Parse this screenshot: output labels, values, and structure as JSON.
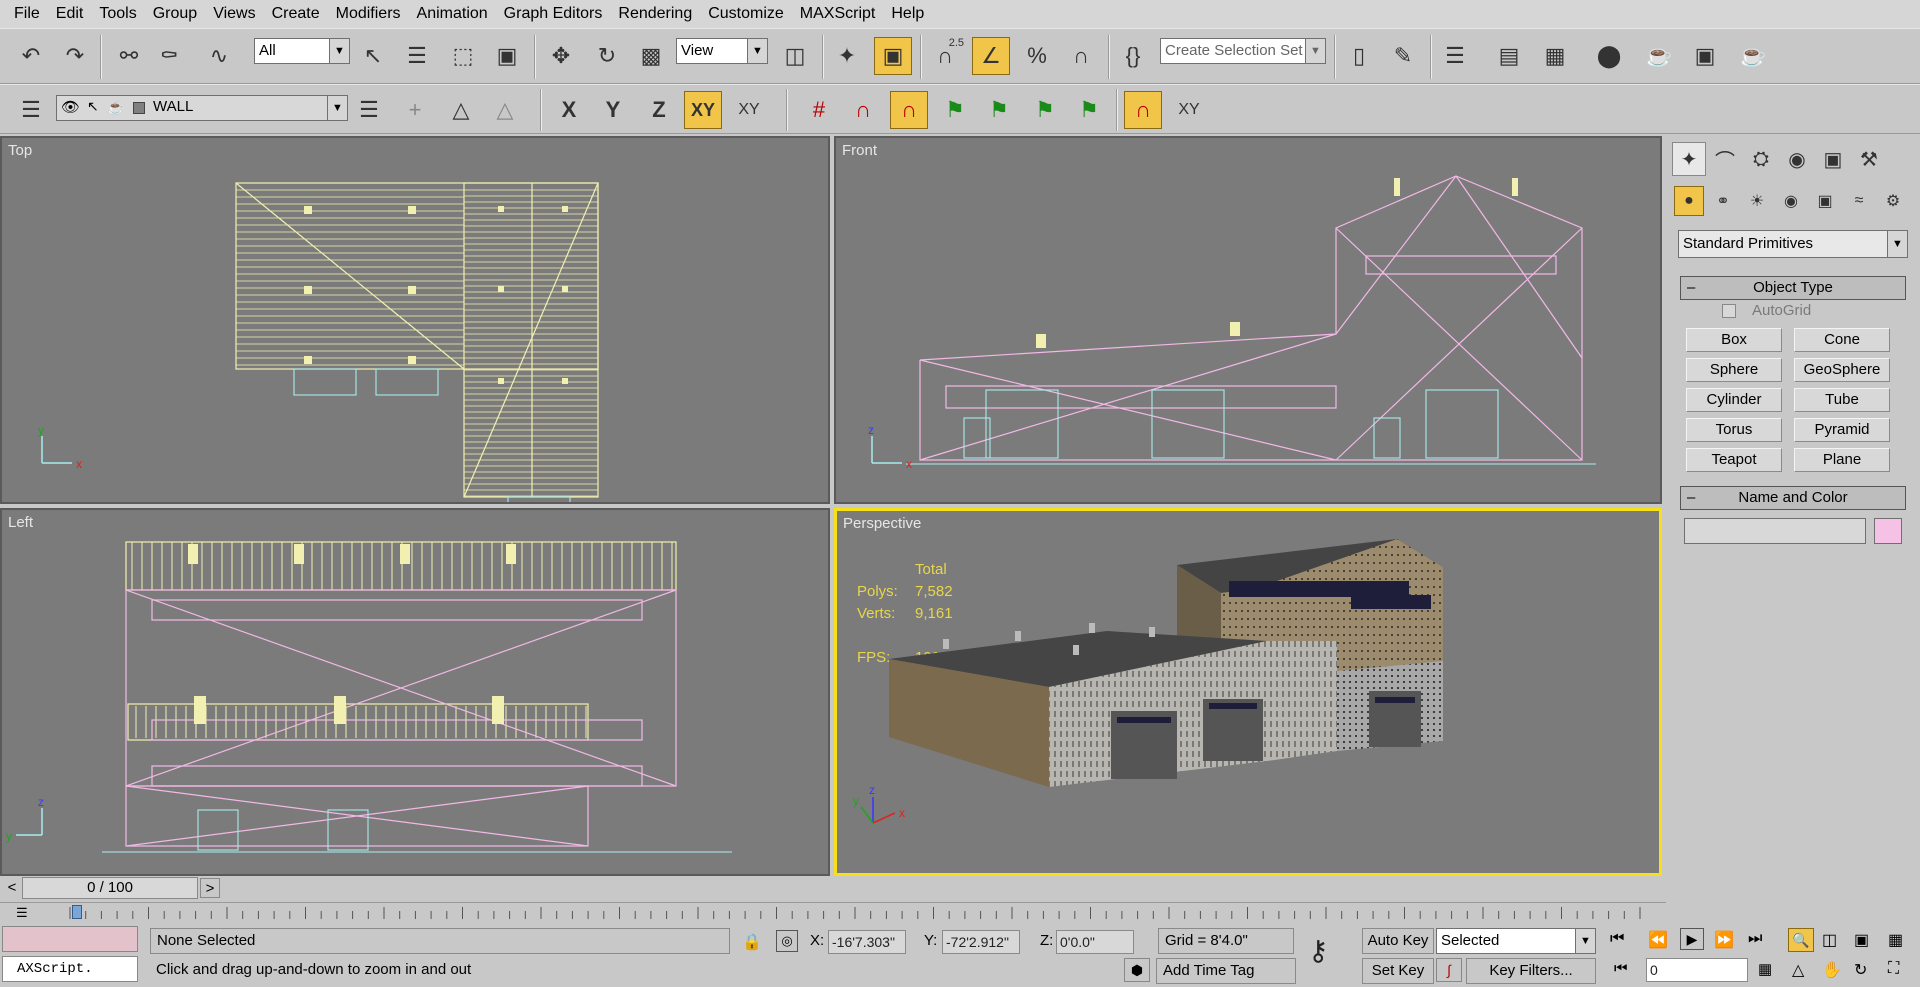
{
  "menu": [
    "File",
    "Edit",
    "Tools",
    "Group",
    "Views",
    "Create",
    "Modifiers",
    "Animation",
    "Graph Editors",
    "Rendering",
    "Customize",
    "MAXScript",
    "Help"
  ],
  "toolbar1": {
    "selection_filter": "All",
    "reference_coord": "View",
    "snap_angle_label": "2.5",
    "selection_set_placeholder": "Create Selection Set"
  },
  "toolbar2": {
    "layer_name": "WALL",
    "axis_x": "X",
    "axis_y": "Y",
    "axis_z": "Z",
    "axis_xy": "XY",
    "axis_xy2": "XY",
    "axis_xy3": "XY"
  },
  "viewports": {
    "top": "Top",
    "front": "Front",
    "left": "Left",
    "perspective": "Perspective"
  },
  "stats": {
    "total_label": "Total",
    "polys_label": "Polys:",
    "polys_value": "7,582",
    "verts_label": "Verts:",
    "verts_value": "9,161",
    "fps_label": "FPS:",
    "fps_value": "190.534"
  },
  "axes": {
    "x": "x",
    "y": "y",
    "z": "z"
  },
  "command_panel": {
    "category": "Standard Primitives",
    "object_type_header": "Object Type",
    "autogrid_label": "AutoGrid",
    "buttons": [
      "Box",
      "Cone",
      "Sphere",
      "GeoSphere",
      "Cylinder",
      "Tube",
      "Torus",
      "Pyramid",
      "Teapot",
      "Plane"
    ],
    "name_color_header": "Name and Color",
    "name_value": "",
    "swatch_color": "#f5c2e6"
  },
  "timeline": {
    "frame_display": "0 / 100",
    "prev_arrow": "<",
    "next_arrow": ">"
  },
  "status": {
    "maxscript_label": "AXScript.",
    "selection_status": "None Selected",
    "prompt": "Click and drag up-and-down to zoom in and out",
    "x_label": "X:",
    "x_value": "-16'7.303\"",
    "y_label": "Y:",
    "y_value": "-72'2.912\"",
    "z_label": "Z:",
    "z_value": "0'0.0\"",
    "grid": "Grid = 8'4.0\"",
    "add_time_tag": "Add Time Tag",
    "auto_key": "Auto Key",
    "set_key": "Set Key",
    "key_mode": "Selected",
    "key_filters": "Key Filters...",
    "current_frame": "0"
  },
  "colors": {
    "viewport_bg": "#7b7b7b",
    "active_border": "#f7e017",
    "wire_yellow": "#f2f0b0",
    "wire_pink": "#f3b8e6",
    "wire_cyan": "#a8ecec",
    "stats_text": "#e8d64a"
  }
}
